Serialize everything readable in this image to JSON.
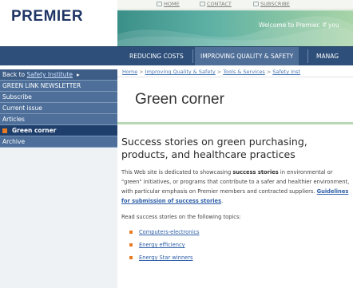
{
  "brand": {
    "logo_text": "PREMIER"
  },
  "header": {
    "top_links": [
      {
        "label": "HOME",
        "icon": "home-icon"
      },
      {
        "label": "CONTACT",
        "icon": "contact-icon"
      },
      {
        "label": "SUBSCRIBE",
        "icon": "subscribe-icon"
      }
    ],
    "welcome": "Welcome to Premier. If you"
  },
  "nav": {
    "tabs": [
      {
        "label": "REDUCING COSTS",
        "active": false
      },
      {
        "label": "IMPROVING QUALITY & SAFETY",
        "active": true
      },
      {
        "label": "MANAG",
        "active": false
      }
    ]
  },
  "sidebar": {
    "back": {
      "prefix": "Back to ",
      "link": "Safety Institute",
      "arrow": "▸"
    },
    "items": [
      {
        "label": "GREEN LINK NEWSLETTER"
      },
      {
        "label": "Subscribe"
      },
      {
        "label": "Current issue"
      },
      {
        "label": "Articles"
      },
      {
        "label": "Green corner",
        "active": true
      },
      {
        "label": "Archive"
      }
    ]
  },
  "breadcrumb": {
    "items": [
      "Home",
      "Improving Quality & Safety",
      "Tools & Services",
      "Safety Inst"
    ],
    "separator": ">"
  },
  "page": {
    "title": "Green corner",
    "heading": "Success stories on green purchasing, products, and healthcare practices",
    "intro": {
      "part1": "This Web site is dedicated to showcasing ",
      "bold1": "success stories",
      "part2": " in environmental or \"green\" initiatives, or programs that contribute to a safer and healthier environment, with particular emphasis on Premier members and contracted suppliers. ",
      "link": "Guidelines for submission of success stories",
      "end": "."
    },
    "read_label": "Read success stories on the following topics:",
    "topics": [
      "Computers-electronics",
      "Energy efficiency",
      "Energy Star winners"
    ]
  },
  "colors": {
    "nav_bg": "#2e4f7a",
    "sidebar_item": "#4d6f9a",
    "sidebar_active": "#1e3e6b",
    "accent_orange": "#e87a22",
    "link_blue": "#2d5ea8",
    "banner_teal": "#3a8f88",
    "title_rule_green": "#b8d7b5"
  }
}
